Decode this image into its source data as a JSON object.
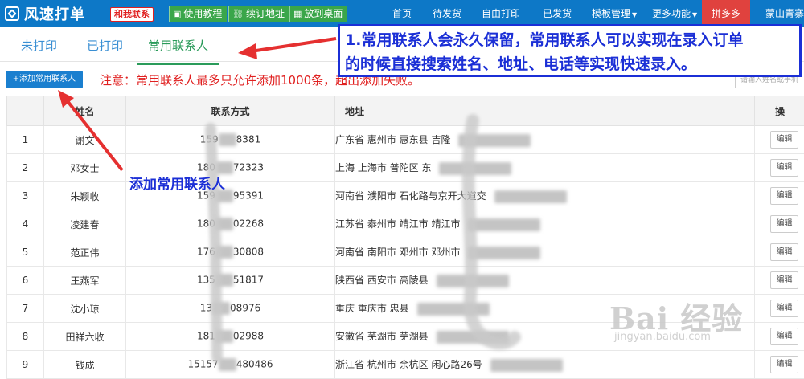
{
  "app": {
    "title": "风速打单"
  },
  "topbar": {
    "contact_chip": "和我联系",
    "buttons": [
      {
        "label": "使用教程",
        "icon": "picture-icon"
      },
      {
        "label": "续订地址",
        "icon": "link-icon"
      },
      {
        "label": "放到桌面",
        "icon": "grid-icon"
      }
    ],
    "nav": [
      {
        "label": "首页"
      },
      {
        "label": "待发货"
      },
      {
        "label": "自由打印"
      },
      {
        "label": "已发货"
      },
      {
        "label": "模板管理"
      },
      {
        "label": "更多功能"
      },
      {
        "label": "拼多多"
      },
      {
        "label": "蒙山青寨"
      }
    ],
    "colors": {
      "bar": "#0d78c7",
      "pdd": "#e0423e",
      "tool_button": "#3aa64a"
    }
  },
  "tabs": [
    {
      "label": "未打印"
    },
    {
      "label": "已打印"
    },
    {
      "label": "常用联系人",
      "active": true
    }
  ],
  "toolbar": {
    "add_button": "+添加常用联系人",
    "notice": "注意：常用联系人最多只允许添加1000条，超出添加失败。",
    "search_placeholder": "请输入姓名或手机"
  },
  "table": {
    "columns": [
      "",
      "姓名",
      "联系方式",
      "地址",
      "操"
    ],
    "edit_label": "编辑",
    "rows": [
      {
        "idx": "1",
        "name": "谢文",
        "phone_a": "159",
        "phone_b": "8381",
        "address": "广东省  惠州市  惠东县  吉隆"
      },
      {
        "idx": "2",
        "name": "邓女士",
        "phone_a": "180",
        "phone_b": "72323",
        "address": "上海  上海市  普陀区  东"
      },
      {
        "idx": "3",
        "name": "朱颖收",
        "phone_a": "159",
        "phone_b": "95391",
        "address": "河南省  濮阳市    石化路与京开大道交"
      },
      {
        "idx": "4",
        "name": "凌建春",
        "phone_a": "180",
        "phone_b": "02268",
        "address": "江苏省  泰州市  靖江市  靖江市"
      },
      {
        "idx": "5",
        "name": "范正伟",
        "phone_a": "176",
        "phone_b": "30808",
        "address": "河南省  南阳市  邓州市  邓州市"
      },
      {
        "idx": "6",
        "name": "王燕军",
        "phone_a": "135",
        "phone_b": "51817",
        "address": "陕西省  西安市  高陵县"
      },
      {
        "idx": "7",
        "name": "沈小琼",
        "phone_a": "13",
        "phone_b": "08976",
        "address": "重庆  重庆市  忠县"
      },
      {
        "idx": "8",
        "name": "田祥六收",
        "phone_a": "181",
        "phone_b": "02988",
        "address": "安徽省  芜湖市  芜湖县"
      },
      {
        "idx": "9",
        "name": "钱成",
        "phone_a": "15157",
        "phone_b": "480486",
        "address": "浙江省  杭州市  余杭区  闲心路26号"
      }
    ]
  },
  "annotations": {
    "callout_line1": "1.常用联系人会永久保留，常用联系人可以实现在录入订单",
    "callout_line2": "的时候直接搜索姓名、地址、电话等实现快速录入。",
    "add_label": "添加常用联系人",
    "color": "#1b2fd6",
    "arrow_color": "#e53030"
  },
  "watermark": {
    "main": "Bai 经验",
    "sub": "jingyan.baidu.com"
  }
}
